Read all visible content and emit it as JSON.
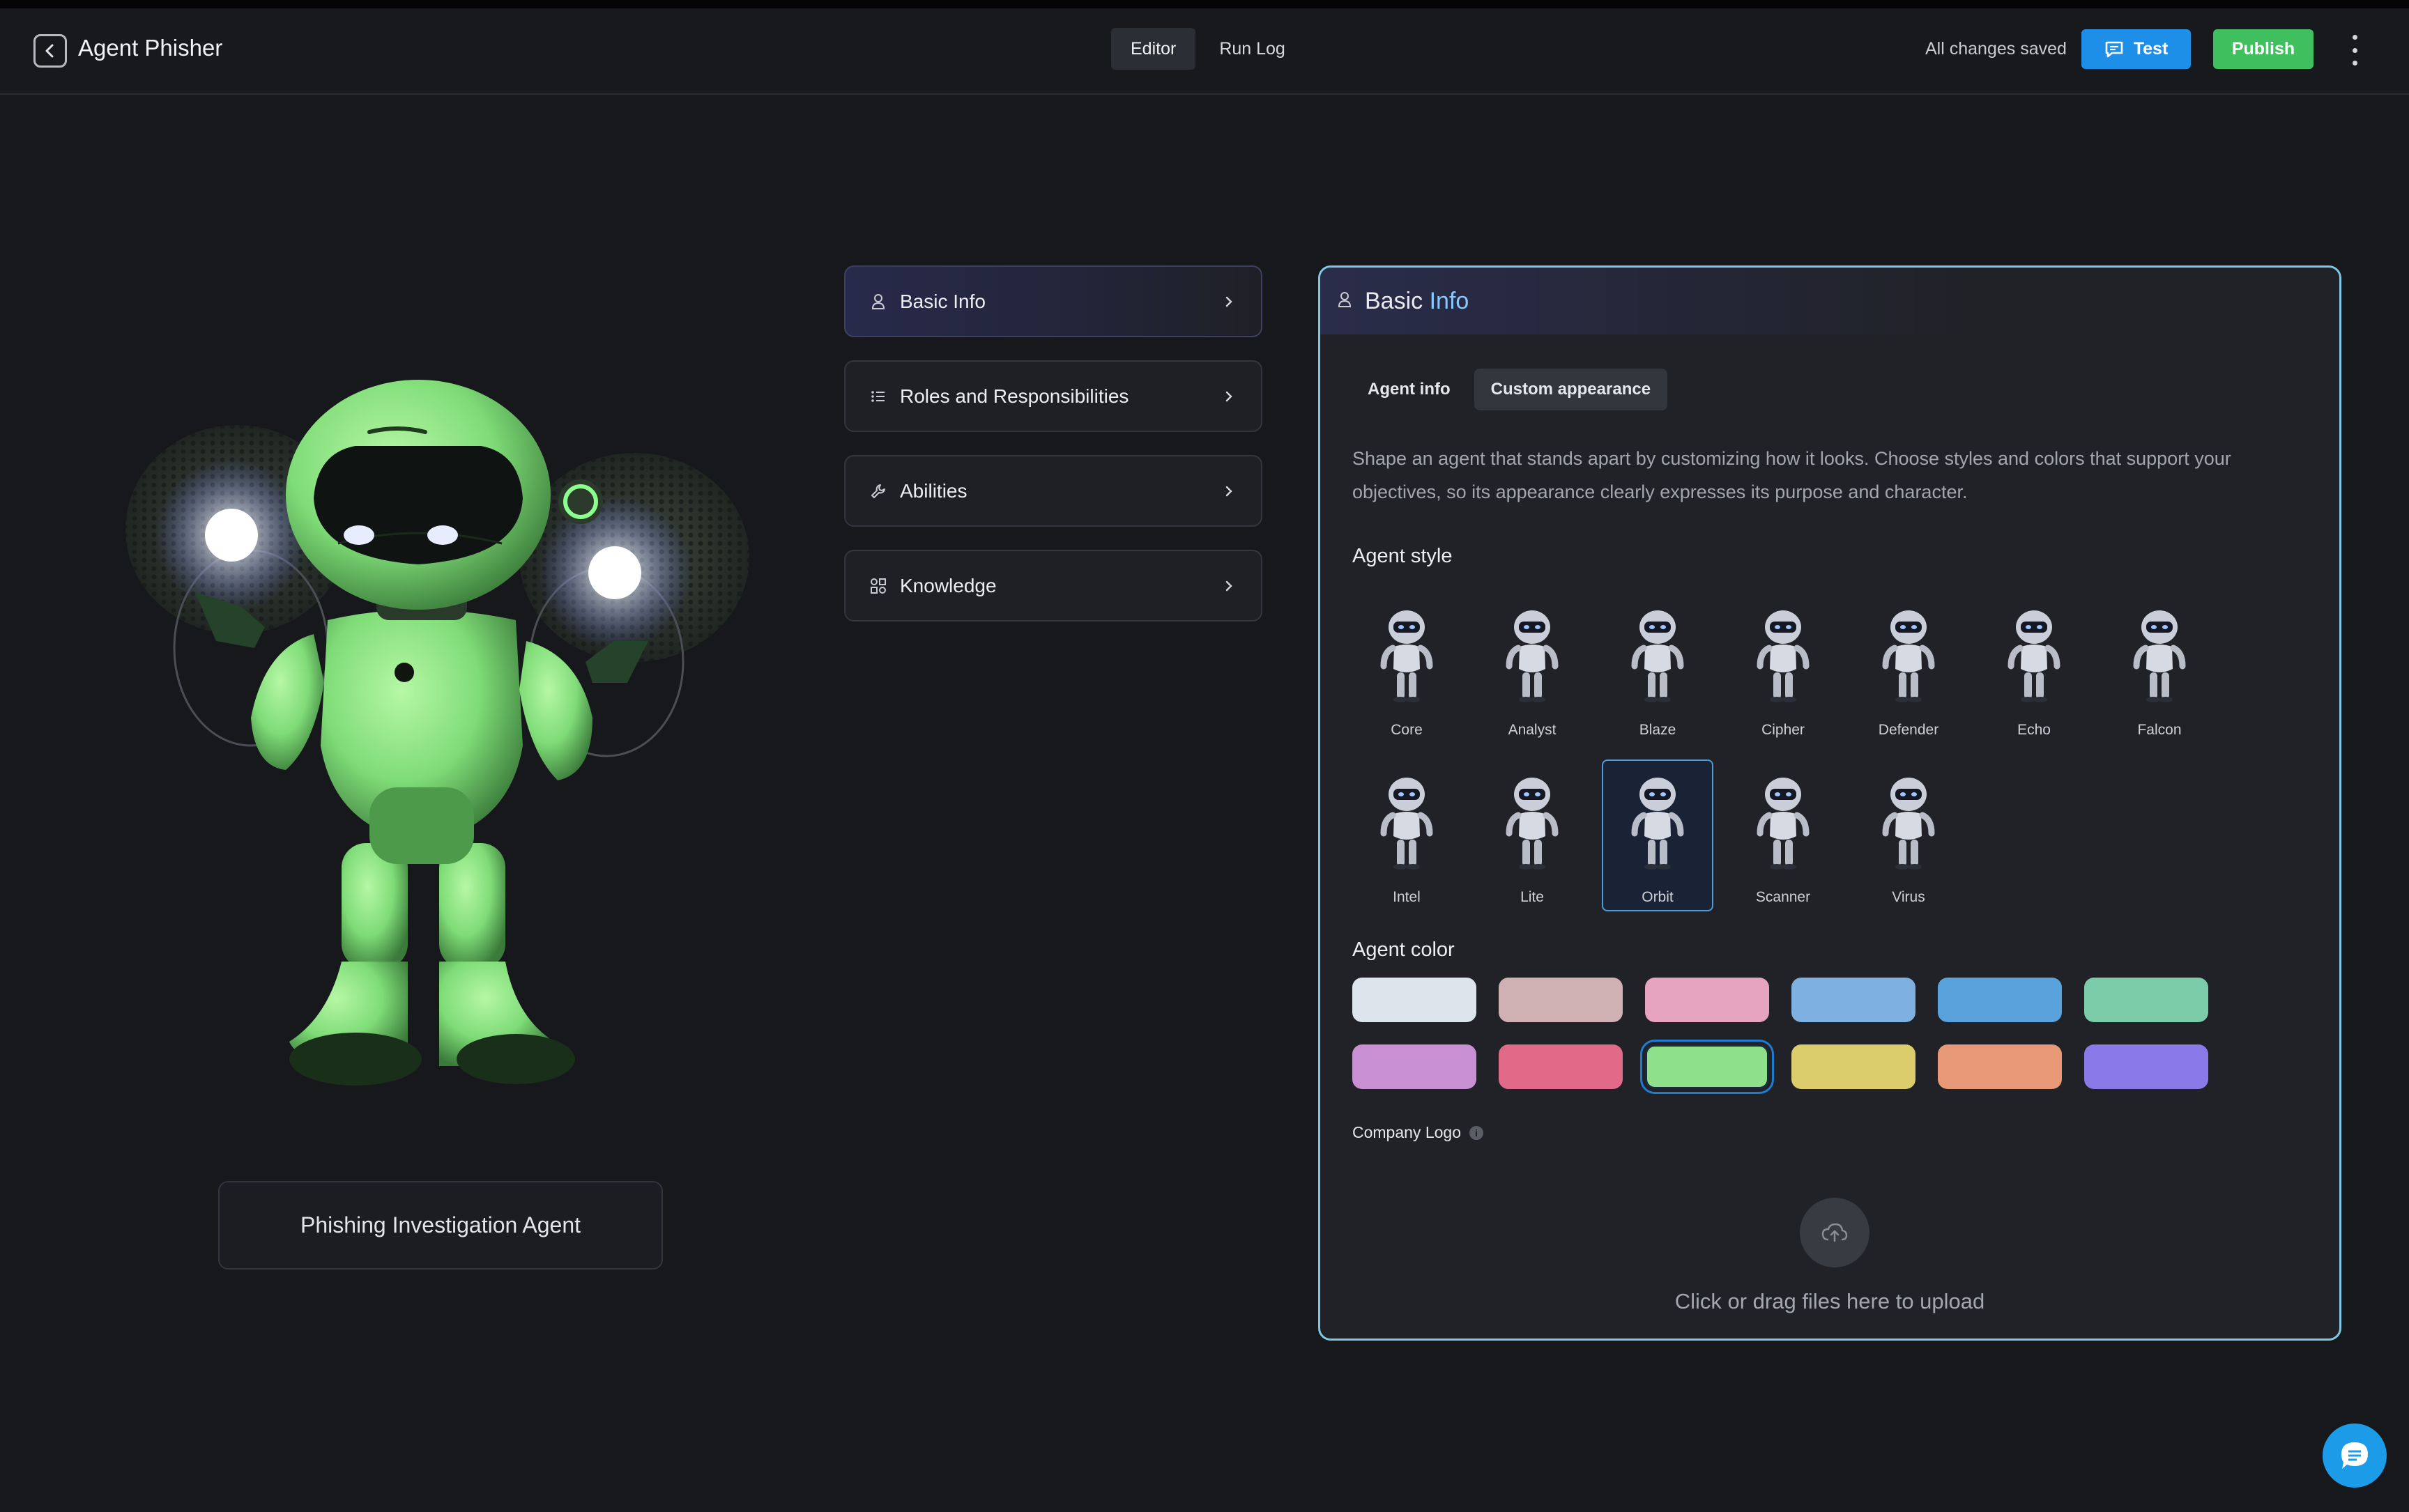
{
  "header": {
    "title": "Agent Phisher",
    "tabs": [
      {
        "label": "Editor",
        "active": true
      },
      {
        "label": "Run Log",
        "active": false
      }
    ],
    "save_status": "All changes saved",
    "test_label": "Test",
    "publish_label": "Publish"
  },
  "agent": {
    "name": "Phishing Investigation Agent",
    "color": "#8fe08a"
  },
  "menu": {
    "items": [
      {
        "label": "Basic Info",
        "icon": "user-icon",
        "active": true
      },
      {
        "label": "Roles and Responsibilities",
        "icon": "list-icon",
        "active": false
      },
      {
        "label": "Abilities",
        "icon": "wrench-icon",
        "active": false
      },
      {
        "label": "Knowledge",
        "icon": "shapes-icon",
        "active": false
      }
    ]
  },
  "panel": {
    "title_part1": "Basic",
    "title_part2": "Info",
    "subtabs": [
      {
        "label": "Agent info",
        "active": false
      },
      {
        "label": "Custom appearance",
        "active": true
      }
    ],
    "description": "Shape an agent that stands apart by customizing how it looks. Choose styles and colors that support your objectives, so its appearance clearly expresses its purpose and character.",
    "style_label": "Agent style",
    "styles": [
      "Core",
      "Analyst",
      "Blaze",
      "Cipher",
      "Defender",
      "Echo",
      "Falcon",
      "Intel",
      "Lite",
      "Orbit",
      "Scanner",
      "Virus"
    ],
    "selected_style": "Orbit",
    "color_label": "Agent color",
    "colors": [
      "#dde4ec",
      "#cfb0b3",
      "#e7a4c1",
      "#7fb1e0",
      "#5aa2dc",
      "#7ccba9",
      "#c98fd3",
      "#e06a88",
      "#8fe08a",
      "#dccd6c",
      "#e89a78",
      "#8a7ae8"
    ],
    "selected_color": "#8fe08a",
    "logo_label": "Company Logo",
    "upload_text": "Click or drag files here to upload"
  }
}
